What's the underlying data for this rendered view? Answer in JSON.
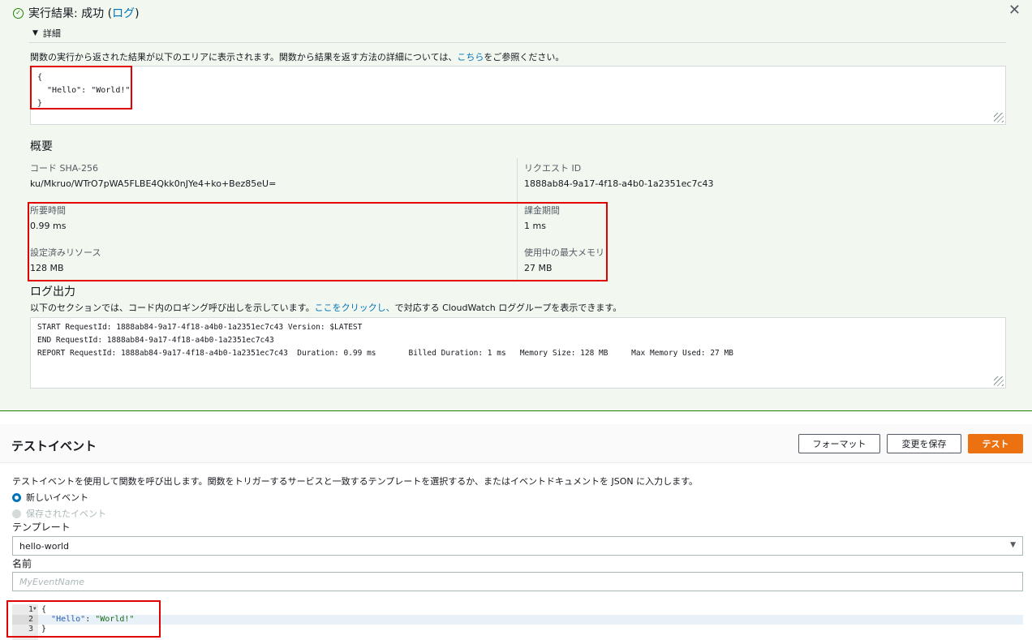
{
  "result": {
    "title_prefix": "実行結果: 成功 (",
    "log_link": "ログ",
    "title_suffix": ")",
    "details_label": "詳細",
    "description_prefix": "関数の実行から返された結果が以下のエリアに表示されます。関数から結果を返す方法の詳細については、",
    "description_link": "こちら",
    "description_suffix": "をご参照ください。",
    "output": "{\n  \"Hello\": \"World!\"\n}"
  },
  "summary": {
    "title": "概要",
    "code_sha_label": "コード SHA-256",
    "code_sha_value": "ku/Mkruo/WTrO7pWA5FLBE4Qkk0nJYe4+ko+Bez85eU=",
    "request_id_label": "リクエスト ID",
    "request_id_value": "1888ab84-9a17-4f18-a4b0-1a2351ec7c43",
    "duration_label": "所要時間",
    "duration_value": "0.99 ms",
    "billed_label": "課金期間",
    "billed_value": "1 ms",
    "resources_label": "設定済みリソース",
    "resources_value": "128 MB",
    "max_memory_label": "使用中の最大メモリ",
    "max_memory_value": "27 MB"
  },
  "log_output": {
    "title": "ログ出力",
    "description_prefix": "以下のセクションでは、コード内のロギング呼び出しを示しています。",
    "description_link": "ここをクリックし、",
    "description_suffix": "で対応する CloudWatch ロググループを表示できます。",
    "lines": "START RequestId: 1888ab84-9a17-4f18-a4b0-1a2351ec7c43 Version: $LATEST\nEND RequestId: 1888ab84-9a17-4f18-a4b0-1a2351ec7c43\nREPORT RequestId: 1888ab84-9a17-4f18-a4b0-1a2351ec7c43  Duration: 0.99 ms       Billed Duration: 1 ms   Memory Size: 128 MB     Max Memory Used: 27 MB"
  },
  "test_event": {
    "title": "テストイベント",
    "format_button": "フォーマット",
    "save_button": "変更を保存",
    "test_button": "テスト",
    "description": "テストイベントを使用して関数を呼び出します。関数をトリガーするサービスと一致するテンプレートを選択するか、またはイベントドキュメントを JSON に入力します。",
    "radio_new": "新しいイベント",
    "radio_saved": "保存されたイベント",
    "template_label": "テンプレート",
    "template_value": "hello-world",
    "name_label": "名前",
    "name_placeholder": "MyEventName",
    "editor": {
      "line_numbers": [
        "1",
        "2",
        "3"
      ],
      "line1": "{",
      "key": "\"Hello\"",
      "colon": ": ",
      "value": "\"World!\"",
      "line3": "}"
    }
  }
}
